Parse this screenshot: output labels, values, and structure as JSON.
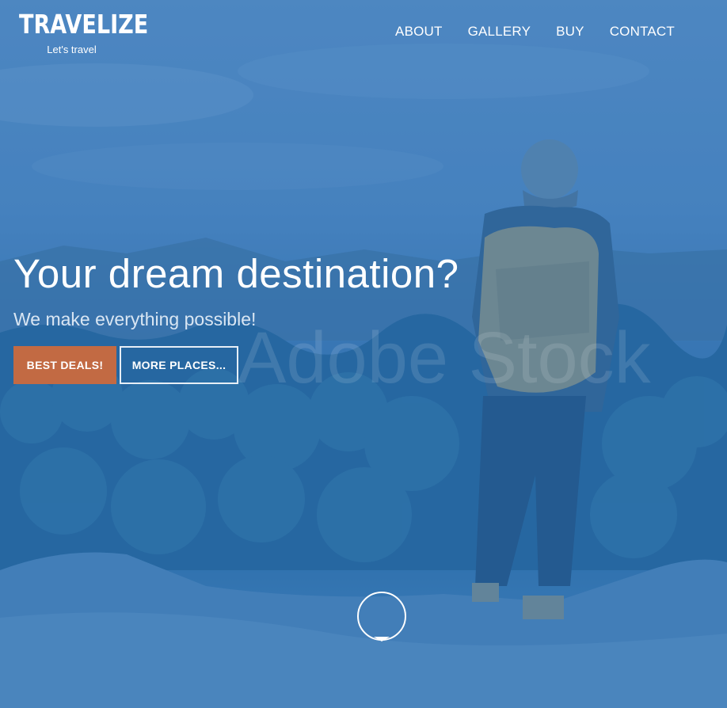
{
  "brand": {
    "name": "TRAVELIZE",
    "tagline": "Let's travel"
  },
  "nav": {
    "items": [
      {
        "label": "ABOUT"
      },
      {
        "label": "GALLERY"
      },
      {
        "label": "BUY"
      },
      {
        "label": "CONTACT"
      }
    ]
  },
  "hero": {
    "title": "Your dream destination?",
    "subtitle": "We make everything possible!",
    "primary_button": "BEST DEALS!",
    "secondary_button": "MORE PLACES...",
    "watermark": "Adobe Stock",
    "scroll_icon": "chevron-down-icon"
  },
  "colors": {
    "accent": "#c26a43",
    "overlay": "#3478be",
    "text": "#ffffff"
  }
}
